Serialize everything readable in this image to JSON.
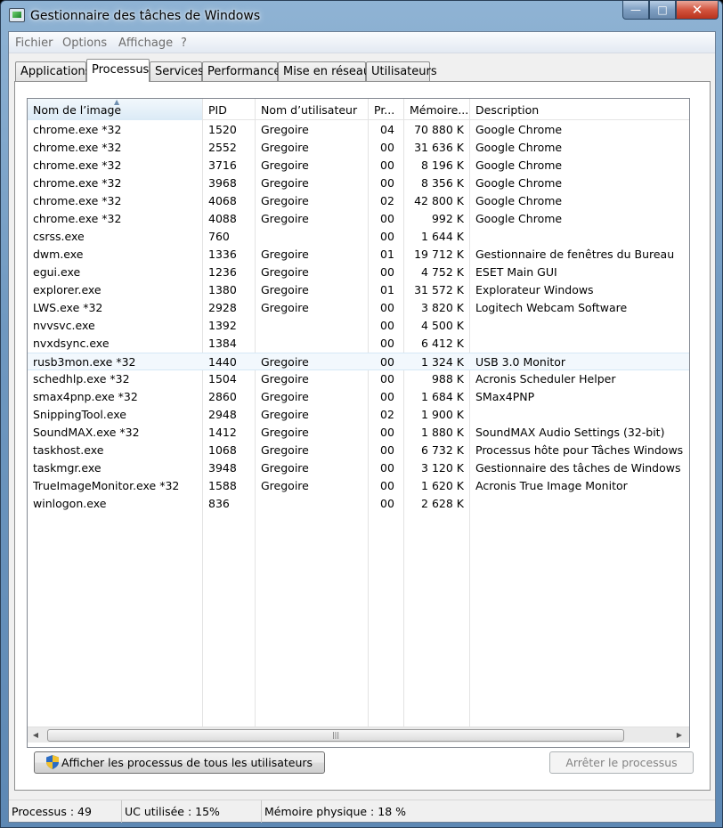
{
  "window": {
    "title": "Gestionnaire des tâches de Windows",
    "controls": {
      "minimize": "—",
      "maximize": "□",
      "close": "✕"
    }
  },
  "menu": [
    "Fichier",
    "Options",
    "Affichage",
    "?"
  ],
  "tabs": [
    {
      "label": "Applications",
      "active": false
    },
    {
      "label": "Processus",
      "active": true
    },
    {
      "label": "Services",
      "active": false
    },
    {
      "label": "Performance",
      "active": false
    },
    {
      "label": "Mise en réseau",
      "active": false
    },
    {
      "label": "Utilisateurs",
      "active": false
    }
  ],
  "table": {
    "columns": [
      "Nom de l’image",
      "PID",
      "Nom d’utilisateur",
      "Pr...",
      "Mémoire...",
      "Description"
    ],
    "sorted_column": "Nom de l’image",
    "hover_row": "rusb3mon.exe *32",
    "rows": [
      [
        "chrome.exe *32",
        "1520",
        "Gregoire",
        "04",
        "70 880 K",
        "Google Chrome"
      ],
      [
        "chrome.exe *32",
        "2552",
        "Gregoire",
        "00",
        "31 636 K",
        "Google Chrome"
      ],
      [
        "chrome.exe *32",
        "3716",
        "Gregoire",
        "00",
        "8 196 K",
        "Google Chrome"
      ],
      [
        "chrome.exe *32",
        "3968",
        "Gregoire",
        "00",
        "8 356 K",
        "Google Chrome"
      ],
      [
        "chrome.exe *32",
        "4068",
        "Gregoire",
        "02",
        "42 800 K",
        "Google Chrome"
      ],
      [
        "chrome.exe *32",
        "4088",
        "Gregoire",
        "00",
        "992 K",
        "Google Chrome"
      ],
      [
        "csrss.exe",
        "760",
        "",
        "00",
        "1 644 K",
        ""
      ],
      [
        "dwm.exe",
        "1336",
        "Gregoire",
        "01",
        "19 712 K",
        "Gestionnaire de fenêtres du Bureau"
      ],
      [
        "egui.exe",
        "1236",
        "Gregoire",
        "00",
        "4 752 K",
        "ESET Main GUI"
      ],
      [
        "explorer.exe",
        "1380",
        "Gregoire",
        "01",
        "31 572 K",
        "Explorateur Windows"
      ],
      [
        "LWS.exe *32",
        "2928",
        "Gregoire",
        "00",
        "3 820 K",
        "Logitech Webcam Software"
      ],
      [
        "nvvsvc.exe",
        "1392",
        "",
        "00",
        "4 500 K",
        ""
      ],
      [
        "nvxdsync.exe",
        "1384",
        "",
        "00",
        "6 412 K",
        ""
      ],
      [
        "rusb3mon.exe *32",
        "1440",
        "Gregoire",
        "00",
        "1 324 K",
        "USB 3.0 Monitor"
      ],
      [
        "schedhlp.exe *32",
        "1504",
        "Gregoire",
        "00",
        "988 K",
        "Acronis Scheduler Helper"
      ],
      [
        "smax4pnp.exe *32",
        "2860",
        "Gregoire",
        "00",
        "1 684 K",
        "SMax4PNP"
      ],
      [
        "SnippingTool.exe",
        "2948",
        "Gregoire",
        "02",
        "1 900 K",
        ""
      ],
      [
        "SoundMAX.exe *32",
        "1412",
        "Gregoire",
        "00",
        "1 880 K",
        "SoundMAX Audio Settings (32-bit)"
      ],
      [
        "taskhost.exe",
        "1068",
        "Gregoire",
        "00",
        "6 732 K",
        "Processus hôte pour Tâches Windows"
      ],
      [
        "taskmgr.exe",
        "3948",
        "Gregoire",
        "00",
        "3 120 K",
        "Gestionnaire des tâches de Windows"
      ],
      [
        "TrueImageMonitor.exe *32",
        "1588",
        "Gregoire",
        "00",
        "1 620 K",
        "Acronis True Image Monitor"
      ],
      [
        "winlogon.exe",
        "836",
        "",
        "00",
        "2 628 K",
        ""
      ]
    ]
  },
  "buttons": {
    "show_all": "Afficher les processus de tous les utilisateurs",
    "end_process": "Arrêter le processus"
  },
  "status": {
    "processes": "Processus : 49",
    "cpu": "UC utilisée : 15%",
    "memory": "Mémoire physique : 18 %"
  },
  "icons": {
    "app": "task-manager-icon",
    "shield": "uac-shield-icon",
    "sort": "sort-ascending-icon"
  }
}
